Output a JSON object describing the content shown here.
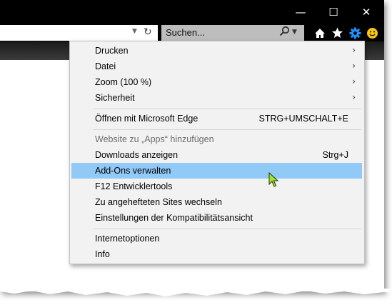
{
  "window": {
    "minimize_icon": "minimize-icon",
    "maximize_icon": "maximize-icon",
    "close_icon": "close-icon"
  },
  "addressbar": {
    "dropdown_icon": "chevron-down-icon",
    "refresh_icon": "refresh-icon"
  },
  "search": {
    "placeholder": "Suchen...",
    "search_icon": "search-icon",
    "dropdown_icon": "chevron-down-icon"
  },
  "toolbar": {
    "icons": [
      "home-icon",
      "favorites-star-icon",
      "settings-gear-icon",
      "feedback-smiley-icon"
    ],
    "gear_color": "#1e90ff",
    "smiley_color": "#f5c518"
  },
  "menu": {
    "groups": [
      [
        {
          "label": "Drucken",
          "submenu": true
        },
        {
          "label": "Datei",
          "submenu": true
        },
        {
          "label": "Zoom (100 %)",
          "submenu": true
        },
        {
          "label": "Sicherheit",
          "submenu": true
        }
      ],
      [
        {
          "label": "Öffnen mit Microsoft Edge",
          "shortcut": "STRG+UMSCHALT+E"
        }
      ],
      [
        {
          "label": "Website zu „Apps“ hinzufügen",
          "disabled": true
        },
        {
          "label": "Downloads anzeigen",
          "shortcut": "Strg+J"
        },
        {
          "label": "Add-Ons verwalten",
          "highlighted": true
        },
        {
          "label": "F12 Entwicklertools"
        },
        {
          "label": "Zu angehefteten Sites wechseln"
        },
        {
          "label": "Einstellungen der Kompatibilitätsansicht"
        }
      ],
      [
        {
          "label": "Internetoptionen"
        },
        {
          "label": "Info"
        }
      ]
    ],
    "submenu_arrow": "›",
    "highlight_color": "#91c9f7"
  }
}
